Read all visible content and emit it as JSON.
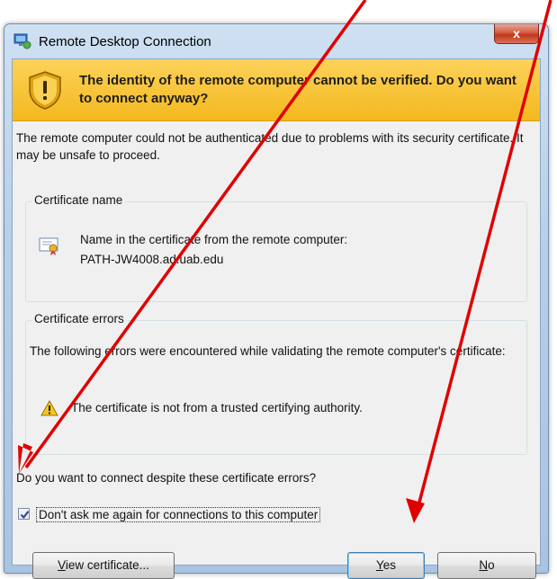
{
  "window": {
    "title": "Remote Desktop Connection",
    "close_glyph": "x"
  },
  "banner": {
    "icon": "shield-warning-icon",
    "text": "The identity of the remote computer cannot be verified. Do you want to connect anyway?"
  },
  "intro": "The remote computer could not be authenticated due to problems with its security certificate. It may be unsafe to proceed.",
  "certificate_name": {
    "group_label": "Certificate name",
    "line1": "Name in the certificate from the remote computer:",
    "line2": "PATH-JW4008.ad.uab.edu"
  },
  "certificate_errors": {
    "group_label": "Certificate errors",
    "intro": "The following errors were encountered while validating the remote computer's certificate:",
    "error_text": "The certificate is not from a trusted certifying authority."
  },
  "question": "Do you want to connect despite these certificate errors?",
  "dont_ask": {
    "label": "Don't ask me again for connections to this computer",
    "checked": true
  },
  "buttons": {
    "view_certificate": {
      "accel": "V",
      "rest": "iew certificate..."
    },
    "yes": {
      "accel": "Y",
      "rest": "es"
    },
    "no": {
      "accel": "N",
      "rest": "o"
    }
  },
  "colors": {
    "annotation_arrow": "#e00000",
    "banner": "#f6c12c",
    "window_frame": "#b7cfe8"
  }
}
